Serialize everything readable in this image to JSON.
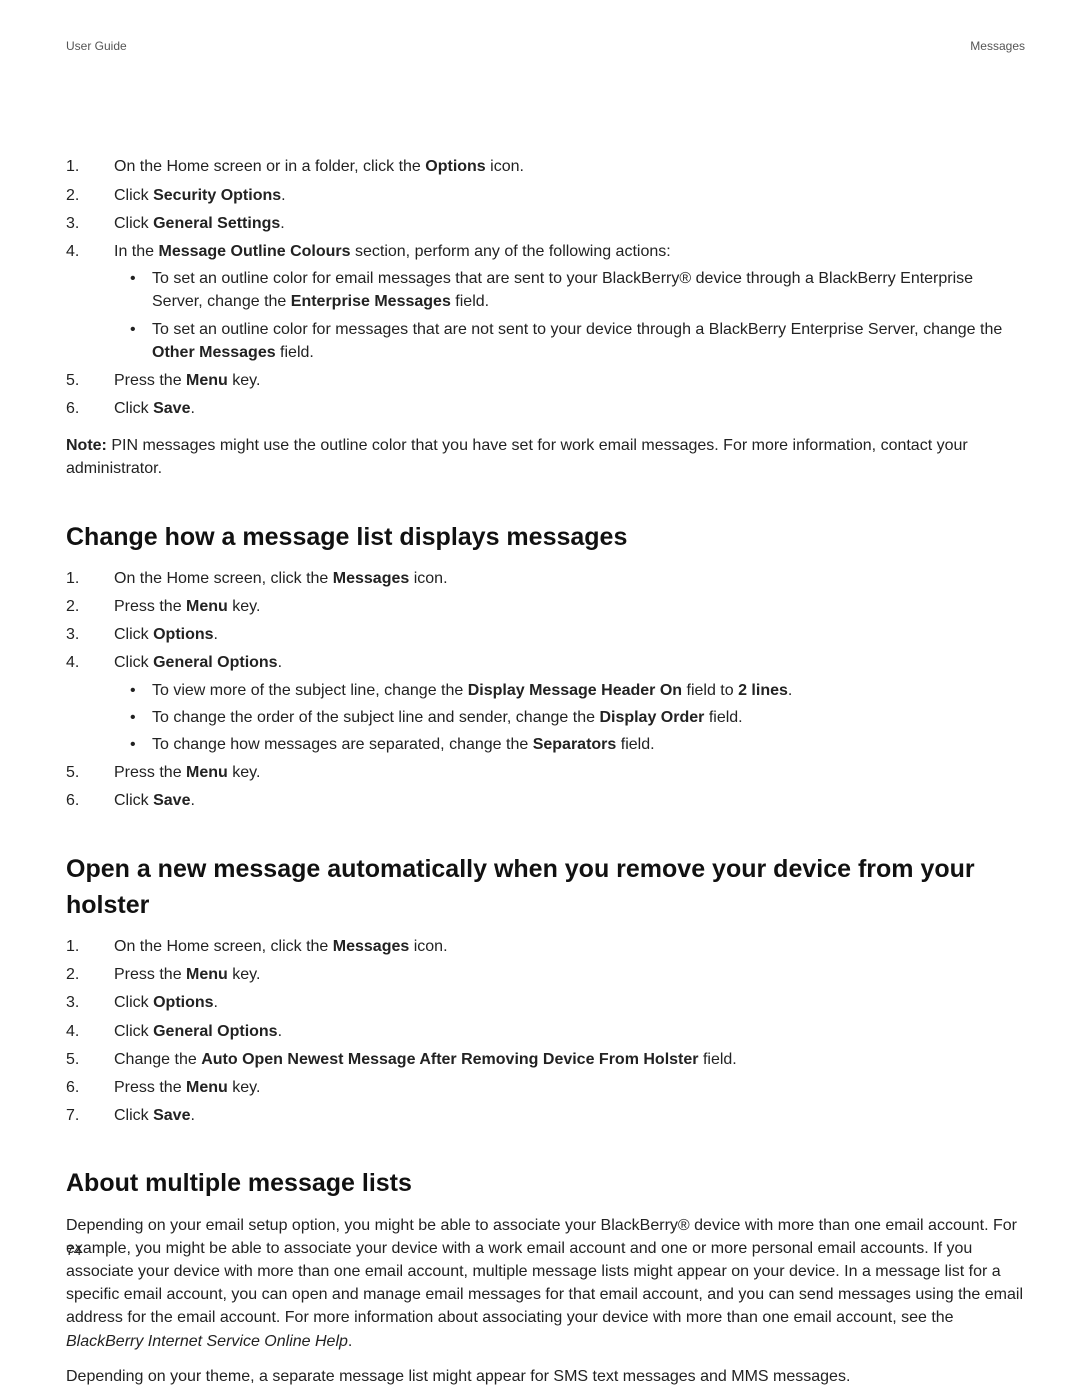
{
  "header": {
    "left": "User Guide",
    "right": "Messages"
  },
  "sec0": {
    "steps": {
      "s1a": "On the Home screen or in a folder, click the ",
      "s1b": "Options",
      "s1c": " icon.",
      "s2a": "Click ",
      "s2b": "Security Options",
      "s2c": ".",
      "s3a": "Click ",
      "s3b": "General Settings",
      "s3c": ".",
      "s4a": "In the ",
      "s4b": "Message Outline Colours",
      "s4c": " section, perform any of the following actions:",
      "s4_b1a": "To set an outline color for email messages that are sent to your BlackBerry® device through a BlackBerry Enterprise Server, change the ",
      "s4_b1b": "Enterprise Messages",
      "s4_b1c": " field.",
      "s4_b2a": "To set an outline color for messages that are not sent to your device through a BlackBerry Enterprise Server, change the ",
      "s4_b2b": "Other Messages",
      "s4_b2c": " field.",
      "s5a": "Press the ",
      "s5b": "Menu",
      "s5c": " key.",
      "s6a": "Click ",
      "s6b": "Save",
      "s6c": "."
    },
    "note_label": "Note:",
    "note_body": "  PIN messages might use the outline color that you have set for work email messages. For more information, contact your administrator."
  },
  "sec1": {
    "heading": "Change how a message list displays messages",
    "steps": {
      "s1a": "On the Home screen, click the ",
      "s1b": "Messages",
      "s1c": " icon.",
      "s2a": "Press the ",
      "s2b": "Menu",
      "s2c": " key.",
      "s3a": "Click ",
      "s3b": "Options",
      "s3c": ".",
      "s4a": "Click ",
      "s4b": "General Options",
      "s4c": ".",
      "s4_b1a": "To view more of the subject line, change the ",
      "s4_b1b": "Display Message Header On",
      "s4_b1c": " field to ",
      "s4_b1d": "2 lines",
      "s4_b1e": ".",
      "s4_b2a": "To change the order of the subject line and sender, change the ",
      "s4_b2b": "Display Order",
      "s4_b2c": " field.",
      "s4_b3a": "To change how messages are separated, change the ",
      "s4_b3b": "Separators",
      "s4_b3c": " field.",
      "s5a": "Press the ",
      "s5b": "Menu",
      "s5c": " key.",
      "s6a": "Click ",
      "s6b": "Save",
      "s6c": "."
    }
  },
  "sec2": {
    "heading": "Open a new message automatically when you remove your device from your holster",
    "steps": {
      "s1a": "On the Home screen, click the ",
      "s1b": "Messages",
      "s1c": " icon.",
      "s2a": "Press the ",
      "s2b": "Menu",
      "s2c": " key.",
      "s3a": "Click ",
      "s3b": "Options",
      "s3c": ".",
      "s4a": "Click ",
      "s4b": "General Options",
      "s4c": ".",
      "s5a": "Change the ",
      "s5b": "Auto Open Newest Message After Removing Device From Holster",
      "s5c": " field.",
      "s6a": "Press the ",
      "s6b": "Menu",
      "s6c": " key.",
      "s7a": "Click ",
      "s7b": "Save",
      "s7c": "."
    }
  },
  "sec3": {
    "heading": "About multiple message lists",
    "p1a": "Depending on your email setup option, you might be able to associate your BlackBerry® device with more than one email account. For example, you might be able to associate your device with a work email account and one or more personal email accounts. If you associate your device with more than one email account, multiple message lists might appear on your device. In a message list for a specific email account, you can open and manage email messages for that email account, and you can send messages using the email address for the email account. For more information about associating your device with more than one email account, see the ",
    "p1b": "BlackBerry Internet Service Online Help",
    "p1c": ".",
    "p2": "Depending on your theme, a separate message list might appear for SMS text messages and MMS messages."
  },
  "page_number": "74"
}
